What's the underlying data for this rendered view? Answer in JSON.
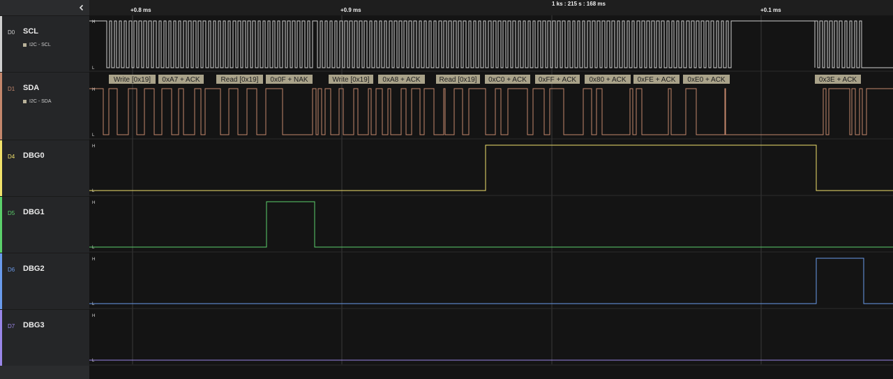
{
  "ruler": {
    "labels": [
      "+0.8 ms",
      "+0.9 ms",
      "1 ks : 215 s : 168 ms",
      "+0.1 ms"
    ]
  },
  "sidebar": {
    "collapse_icon": "chevron-left-icon"
  },
  "channels": [
    {
      "index": "D0",
      "name": "SCL",
      "analyzer": "I2C - SCL",
      "color": "#cfcfcf"
    },
    {
      "index": "D1",
      "name": "SDA",
      "analyzer": "I2C - SDA",
      "color": "#c4876c"
    },
    {
      "index": "D4",
      "name": "DBG0",
      "analyzer": "",
      "color": "#f2e26b"
    },
    {
      "index": "D5",
      "name": "DBG1",
      "analyzer": "",
      "color": "#5bd06b"
    },
    {
      "index": "D6",
      "name": "DBG2",
      "analyzer": "",
      "color": "#6a9bec"
    },
    {
      "index": "D7",
      "name": "DBG3",
      "analyzer": "",
      "color": "#9a86e8"
    }
  ],
  "level_labels": {
    "high": "H",
    "low": "L"
  },
  "decoded_frames": [
    "Write [0x19]",
    "0xA7 + ACK",
    "Read [0x19]",
    "0x0F + NAK",
    "Write [0x19]",
    "0xA8 + ACK",
    "Read [0x19]",
    "0xC0 + ACK",
    "0xFF + ACK",
    "0x80 + ACK",
    "0xFE + ACK",
    "0xE0 + ACK",
    "0x3E + ACK"
  ]
}
